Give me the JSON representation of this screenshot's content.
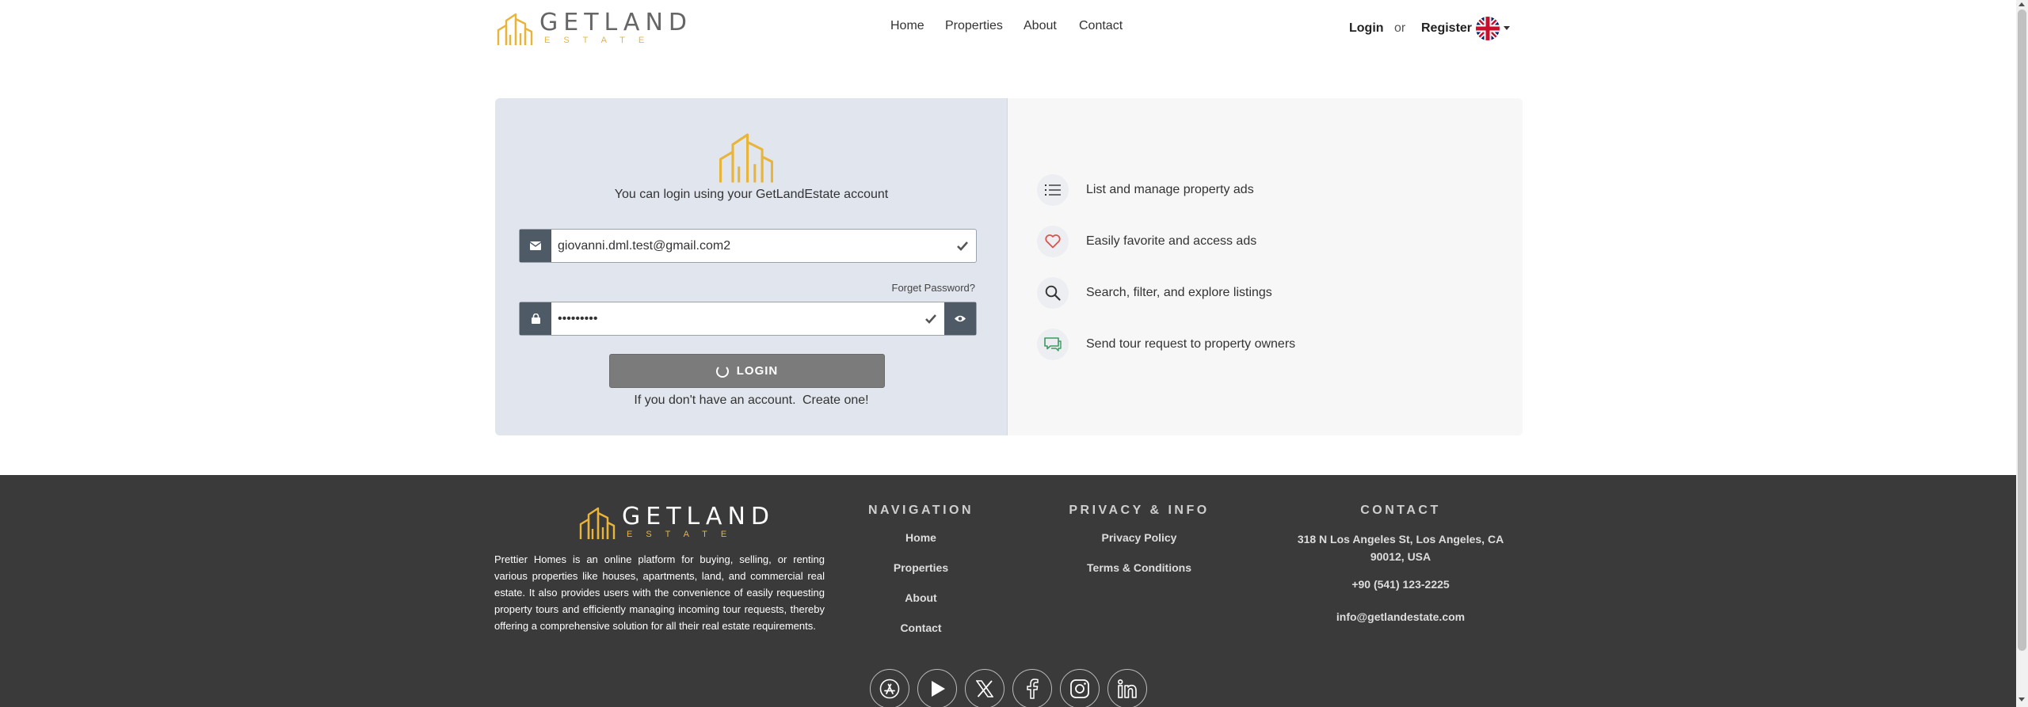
{
  "brand": {
    "name": "GETLAND",
    "tagline": "ESTATE",
    "accent_color": "#e8b53a"
  },
  "header": {
    "nav": {
      "home": "Home",
      "properties": "Properties",
      "about": "About",
      "contact": "Contact"
    },
    "login": "Login",
    "or": "or",
    "register": "Register",
    "language_flag": "uk-flag-icon"
  },
  "login": {
    "subtitle": "You can login using your GetLandEstate account",
    "email": {
      "value": "giovanni.dml.test@gmail.com2",
      "icon": "envelope-icon"
    },
    "forget_password": "Forget Password?",
    "password": {
      "value": "•••••••••",
      "icon": "lock-icon"
    },
    "button_label": "LOGIN",
    "signup_prompt": "If you don't have an account.",
    "signup_link": "Create one!"
  },
  "features": [
    {
      "icon": "list-icon",
      "label": "List and manage property ads"
    },
    {
      "icon": "heart-icon",
      "label": "Easily favorite and access ads"
    },
    {
      "icon": "search-icon",
      "label": "Search, filter, and explore listings"
    },
    {
      "icon": "chat-icon",
      "label": "Send tour request to property owners"
    }
  ],
  "footer": {
    "about": "Prettier Homes is an online platform for buying, selling, or renting various properties like houses, apartments, land, and commercial real estate. It also provides users with the convenience of easily requesting property tours and efficiently managing incoming tour requests, thereby offering a comprehensive solution for all their real estate requirements.",
    "navigation": {
      "title": "NAVIGATION",
      "links": [
        "Home",
        "Properties",
        "About",
        "Contact"
      ]
    },
    "privacy": {
      "title": "PRIVACY & INFO",
      "links": [
        "Privacy Policy",
        "Terms & Conditions"
      ]
    },
    "contact": {
      "title": "CONTACT",
      "address": "318 N Los Angeles St, Los Angeles, CA 90012, USA",
      "phone": "+90 (541) 123-2225",
      "email": "info@getlandestate.com"
    },
    "socials": [
      "app-store-icon",
      "youtube-icon",
      "x-icon",
      "facebook-icon",
      "instagram-icon",
      "linkedin-icon"
    ]
  }
}
